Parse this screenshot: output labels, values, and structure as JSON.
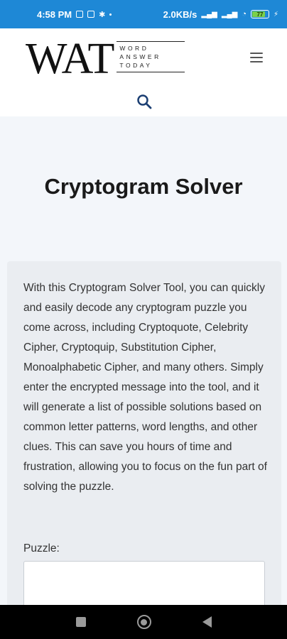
{
  "status_bar": {
    "time": "4:58 PM",
    "network_speed": "2.0KB/s",
    "battery": "77"
  },
  "header": {
    "logo_main": "WAT",
    "logo_lines": [
      "WORD",
      "ANSWER",
      "TODAY"
    ],
    "menu_icon": "hamburger-icon",
    "search_icon": "search-icon"
  },
  "page": {
    "title": "Cryptogram Solver",
    "description": "With this Cryptogram Solver Tool, you can quickly and easily decode any cryptogram puzzle you come across, including Cryptoquote, Celebrity Cipher, Cryptoquip, Substitution Cipher, Monoalphabetic Cipher, and many others. Simply enter the encrypted message into the tool, and it will generate a list of possible solutions based on common letter patterns, word lengths, and other clues. This can save you hours of time and frustration, allowing you to focus on the fun part of solving the puzzle.",
    "puzzle_label": "Puzzle:",
    "puzzle_value": ""
  },
  "colors": {
    "status_bar": "#1e88d6",
    "accent_icon": "#1c3f73"
  }
}
